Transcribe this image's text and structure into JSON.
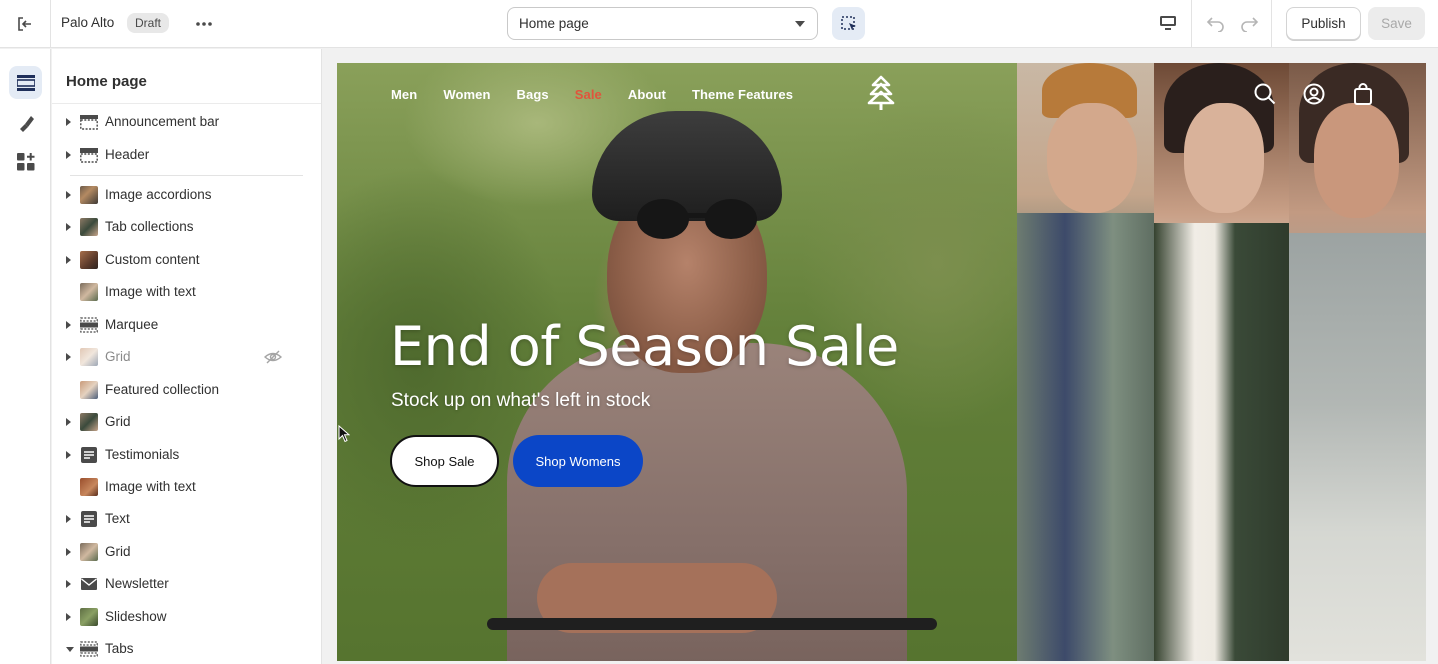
{
  "topbar": {
    "store_name": "Palo Alto",
    "status_badge": "Draft",
    "template_select": "Home page",
    "publish_label": "Publish",
    "save_label": "Save"
  },
  "rail": {
    "items": [
      {
        "icon": "sections-icon",
        "active": true
      },
      {
        "icon": "theme-settings-icon",
        "active": false
      },
      {
        "icon": "apps-icon",
        "active": false
      }
    ]
  },
  "panel": {
    "title": "Home page",
    "sections": [
      {
        "label": "Announcement bar",
        "icon": "announcement-bar-icon",
        "expandable": true,
        "hidden": false
      },
      {
        "label": "Header",
        "icon": "header-icon",
        "expandable": true,
        "hidden": false
      },
      {
        "label": "Image accordions",
        "icon": "image-thumbnail",
        "expandable": true,
        "hidden": false
      },
      {
        "label": "Tab collections",
        "icon": "image-thumbnail",
        "expandable": true,
        "hidden": false
      },
      {
        "label": "Custom content",
        "icon": "image-thumbnail",
        "expandable": true,
        "hidden": false
      },
      {
        "label": "Image with text",
        "icon": "image-thumbnail",
        "expandable": false,
        "hidden": false
      },
      {
        "label": "Marquee",
        "icon": "marquee-icon",
        "expandable": true,
        "hidden": false
      },
      {
        "label": "Grid",
        "icon": "image-thumbnail",
        "expandable": true,
        "hidden": true
      },
      {
        "label": "Featured collection",
        "icon": "image-thumbnail",
        "expandable": false,
        "hidden": false
      },
      {
        "label": "Grid",
        "icon": "image-thumbnail",
        "expandable": true,
        "hidden": false
      },
      {
        "label": "Testimonials",
        "icon": "text-block-icon",
        "expandable": true,
        "hidden": false
      },
      {
        "label": "Image with text",
        "icon": "image-thumbnail",
        "expandable": false,
        "hidden": false
      },
      {
        "label": "Text",
        "icon": "text-block-icon",
        "expandable": true,
        "hidden": false
      },
      {
        "label": "Grid",
        "icon": "image-thumbnail",
        "expandable": true,
        "hidden": false
      },
      {
        "label": "Newsletter",
        "icon": "envelope-icon",
        "expandable": true,
        "hidden": false
      },
      {
        "label": "Slideshow",
        "icon": "image-thumbnail",
        "expandable": true,
        "hidden": false
      },
      {
        "label": "Tabs",
        "icon": "tabs-icon",
        "expandable": true,
        "expanded": true,
        "hidden": false
      }
    ]
  },
  "preview": {
    "nav": [
      "Men",
      "Women",
      "Bags",
      "Sale",
      "About",
      "Theme Features"
    ],
    "hero_title": "End of Season Sale",
    "hero_subtitle": "Stock up on what's left in stock",
    "button_primary": "Shop Sale",
    "button_secondary": "Shop Womens",
    "colors": {
      "sale_link": "#e0553c",
      "secondary_button": "#0b46c7",
      "editor_accent": "#e4ebf5"
    }
  }
}
